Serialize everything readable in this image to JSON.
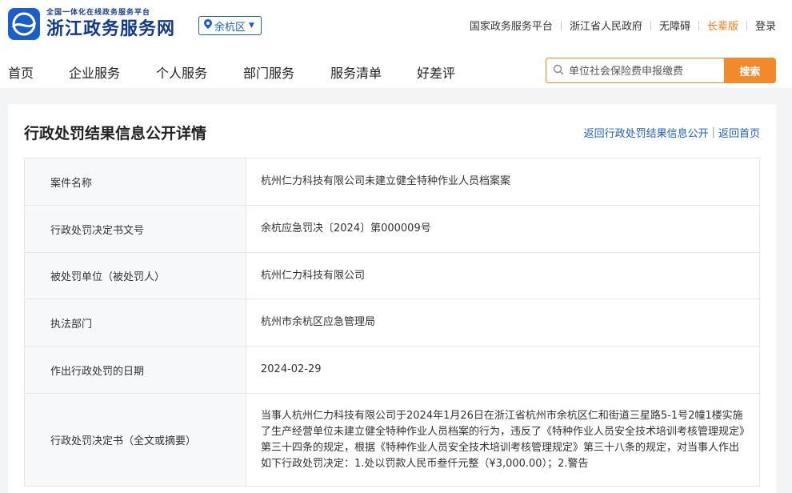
{
  "header": {
    "logo_sub": "全国一体化在线政务服务平台",
    "logo_main": "浙江政务服务网",
    "region": "余杭区",
    "links": [
      "国家政务服务平台",
      "浙江省人民政府",
      "无障碍",
      "长辈版",
      "登录"
    ]
  },
  "nav": {
    "items": [
      "首页",
      "企业服务",
      "个人服务",
      "部门服务",
      "服务清单",
      "好差评"
    ],
    "search_placeholder": "单位社会保险费申报缴费",
    "search_button": "搜索"
  },
  "page": {
    "title": "行政处罚结果信息公开详情",
    "back_list": "返回行政处罚结果信息公开",
    "back_home": "返回首页"
  },
  "details": [
    {
      "label": "案件名称",
      "value": "杭州仁力科技有限公司未建立健全特种作业人员档案案"
    },
    {
      "label": "行政处罚决定书文号",
      "value": "余杭应急罚决〔2024〕第000009号"
    },
    {
      "label": "被处罚单位（被处罚人）",
      "value": "杭州仁力科技有限公司"
    },
    {
      "label": "执法部门",
      "value": "杭州市余杭区应急管理局"
    },
    {
      "label": "作出行政处罚的日期",
      "value": "2024-02-29"
    },
    {
      "label": "行政处罚决定书（全文或摘要）",
      "value": "当事人杭州仁力科技有限公司于2024年1月26日在浙江省杭州市余杭区仁和街道三星路5-1号2幢1楼实施了生产经营单位未建立健全特种作业人员档案的行为，违反了《特种作业人员安全技术培训考核管理规定》第三十四条的规定，根据《特种作业人员安全技术培训考核管理规定》第三十八条的规定，对当事人作出如下行政处罚决定：1.处以罚款人民币叁仟元整（¥3,000.00）；2.警告"
    }
  ],
  "colors": {
    "brand_blue": "#1a5fc9",
    "accent_orange": "#f08a2a"
  }
}
